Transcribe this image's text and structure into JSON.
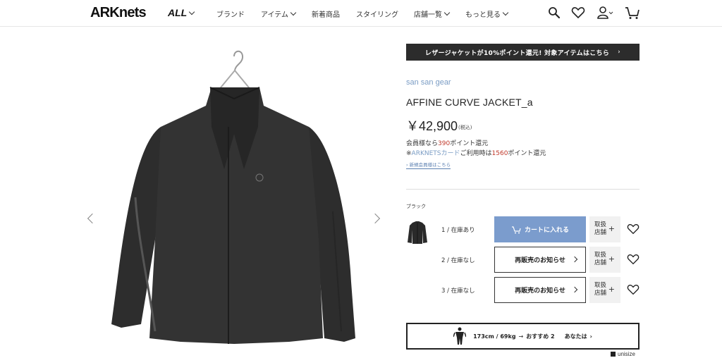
{
  "header": {
    "logo": "ARKnets",
    "all_menu": "ALL",
    "nav": [
      "ブランド",
      "アイテム",
      "新着商品",
      "スタイリング",
      "店舗一覧",
      "もっと見る"
    ]
  },
  "banner": {
    "text": "レザージャケットが10%ポイント還元!  対象アイテムはこちら",
    "arrow": "›"
  },
  "product": {
    "brand": "san san gear",
    "name": "AFFINE CURVE JACKET_a",
    "price": "￥42,900",
    "tax_note": "(税込)",
    "points_prefix": "会員様なら",
    "points_value": "390",
    "points_suffix": "ポイント還元",
    "card_prefix": "※",
    "card_link": "ARKNETSカード",
    "card_mid": "ご利用時は",
    "card_value": "1560",
    "card_suffix": "ポイント還元",
    "new_member_link": "新規会員様はこちら"
  },
  "variant": {
    "color_label": "ブラック",
    "rows": [
      {
        "size": "1 /  在庫あり",
        "button": "カートに入れる",
        "store": [
          "取扱",
          "店舗"
        ]
      },
      {
        "size": "2 /  在庫なし",
        "button": "再販売のお知らせ",
        "store": [
          "取扱",
          "店舗"
        ]
      },
      {
        "size": "3 /  在庫なし",
        "button": "再販売のお知らせ",
        "store": [
          "取扱",
          "店舗"
        ]
      }
    ]
  },
  "unisize": {
    "measure": "173cm / 69kg",
    "arrow": "→",
    "recommend": "おすすめ 2",
    "you": "あなたは",
    "logo": "unisize"
  },
  "colors": {
    "accent_blue": "#7b9ccd",
    "point_red": "#c0392b",
    "brand_blue": "#7a9cc4"
  }
}
